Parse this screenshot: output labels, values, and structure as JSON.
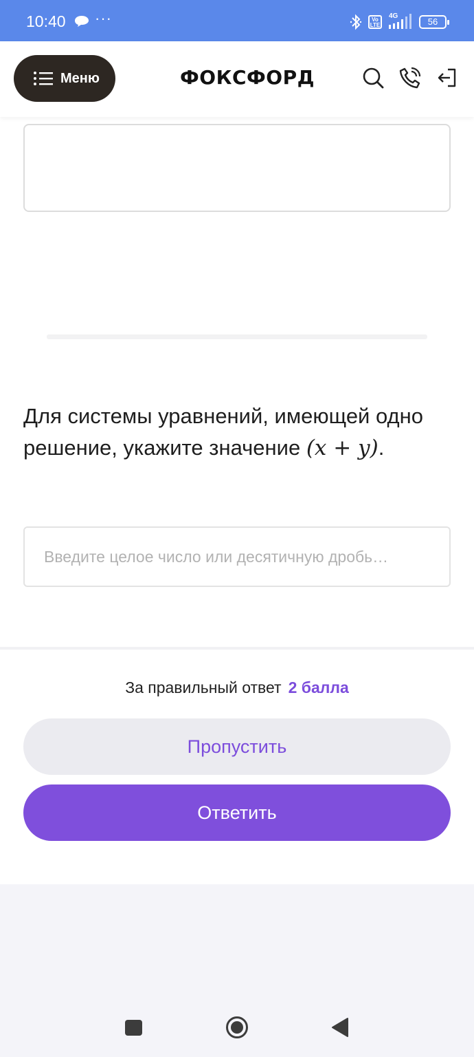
{
  "status_bar": {
    "time": "10:40",
    "dots": "···",
    "volte": "Vo LTE",
    "network": "4G",
    "battery": "56"
  },
  "header": {
    "menu_label": "Меню",
    "logo": "ФОКСФОРД",
    "icons": [
      "search-icon",
      "phone-icon",
      "logout-icon"
    ]
  },
  "question": {
    "text_before": "Для системы уравнений, имеющей одно решение, укажите значение ",
    "math": "(x + y)",
    "text_after": "."
  },
  "answer": {
    "placeholder": "Введите целое число или десятичную дробь…",
    "value": ""
  },
  "footer": {
    "points_label": "За правильный ответ",
    "points_value": "2 балла",
    "skip_label": "Пропустить",
    "submit_label": "Ответить"
  },
  "colors": {
    "status_bar": "#5a88ea",
    "accent": "#7f4fdc",
    "menu_button": "#2d2722",
    "skip_button_bg": "#ebebf0"
  }
}
